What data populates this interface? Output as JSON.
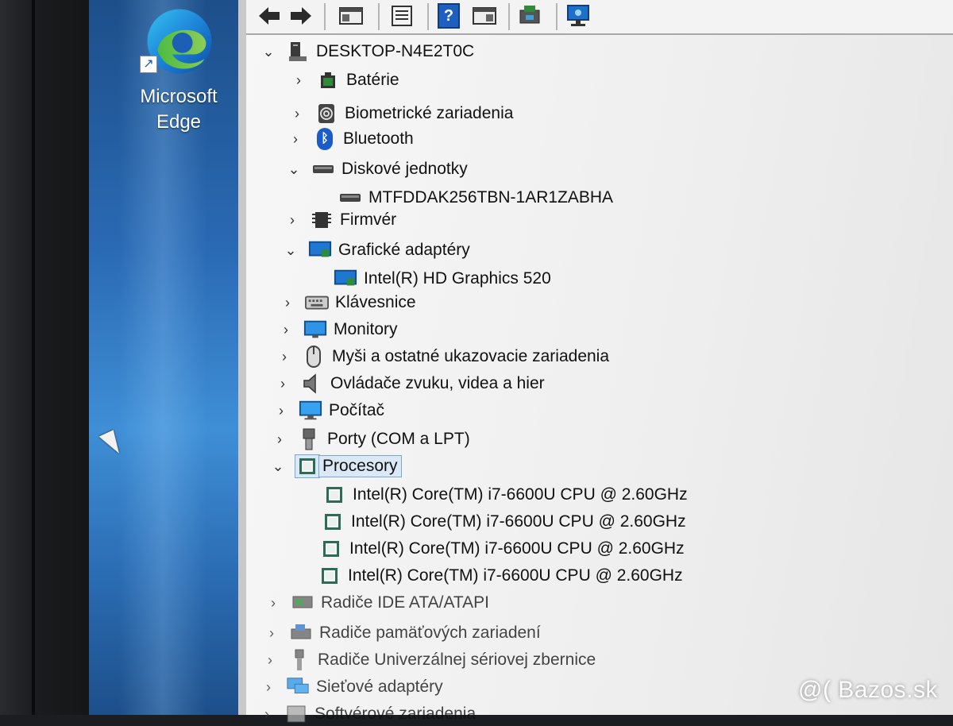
{
  "desktop": {
    "icon_label": "Microsoft Edge",
    "icon_name": "microsoft-edge-icon"
  },
  "toolbar": {
    "buttons": [
      {
        "name": "back-arrow-icon"
      },
      {
        "name": "forward-arrow-icon"
      },
      {
        "name": "show-hide-console-tree-icon"
      },
      {
        "name": "properties-icon"
      },
      {
        "name": "help-icon",
        "label": "?"
      },
      {
        "name": "action-pane-icon"
      },
      {
        "name": "update-driver-icon"
      },
      {
        "name": "scan-hardware-icon"
      }
    ]
  },
  "tree": {
    "root": "DESKTOP-N4E2T0C",
    "items": [
      {
        "label": "Batérie",
        "expanded": false,
        "icon": "battery-icon"
      },
      {
        "label": "Biometrické zariadenia",
        "expanded": false,
        "icon": "fingerprint-icon"
      },
      {
        "label": "Bluetooth",
        "expanded": false,
        "icon": "bluetooth-icon"
      },
      {
        "label": "Diskové jednotky",
        "expanded": true,
        "icon": "disk-drive-icon"
      },
      {
        "label": "MTFDDAK256TBN-1AR1ZABHA",
        "child": true,
        "icon": "disk-drive-icon"
      },
      {
        "label": "Firmvér",
        "expanded": false,
        "icon": "firmware-chip-icon"
      },
      {
        "label": "Grafické adaptéry",
        "expanded": true,
        "icon": "display-adapter-icon"
      },
      {
        "label": "Intel(R) HD Graphics 520",
        "child": true,
        "icon": "display-adapter-icon"
      },
      {
        "label": "Klávesnice",
        "expanded": false,
        "icon": "keyboard-icon"
      },
      {
        "label": "Monitory",
        "expanded": false,
        "icon": "monitor-icon"
      },
      {
        "label": "Myši a ostatné ukazovacie zariadenia",
        "expanded": false,
        "icon": "mouse-icon"
      },
      {
        "label": "Ovládače zvuku, videa a hier",
        "expanded": false,
        "icon": "speaker-icon"
      },
      {
        "label": "Počítač",
        "expanded": false,
        "icon": "computer-icon"
      },
      {
        "label": "Porty (COM a LPT)",
        "expanded": false,
        "icon": "port-icon"
      },
      {
        "label": "Procesory",
        "expanded": true,
        "selected": true,
        "icon": "processor-icon"
      },
      {
        "label": "Intel(R) Core(TM) i7-6600U CPU @ 2.60GHz",
        "child": true,
        "icon": "processor-icon"
      },
      {
        "label": "Intel(R) Core(TM) i7-6600U CPU @ 2.60GHz",
        "child": true,
        "icon": "processor-icon"
      },
      {
        "label": "Intel(R) Core(TM) i7-6600U CPU @ 2.60GHz",
        "child": true,
        "icon": "processor-icon"
      },
      {
        "label": "Intel(R) Core(TM) i7-6600U CPU @ 2.60GHz",
        "child": true,
        "icon": "processor-icon"
      },
      {
        "label": "Radiče IDE ATA/ATAPI",
        "expanded": false,
        "icon": "ide-controller-icon"
      },
      {
        "label": "Radiče pamäťových zariadení",
        "expanded": false,
        "icon": "storage-controller-icon"
      },
      {
        "label": "Radiče Univerzálnej sériovej zbernice",
        "expanded": false,
        "icon": "usb-icon"
      },
      {
        "label": "Sieťové adaptéry",
        "expanded": false,
        "icon": "network-adapter-icon"
      },
      {
        "label": "Softvérové zariadenia",
        "expanded": false,
        "icon": "software-device-icon"
      }
    ]
  },
  "watermark": "@( Bazos.sk"
}
